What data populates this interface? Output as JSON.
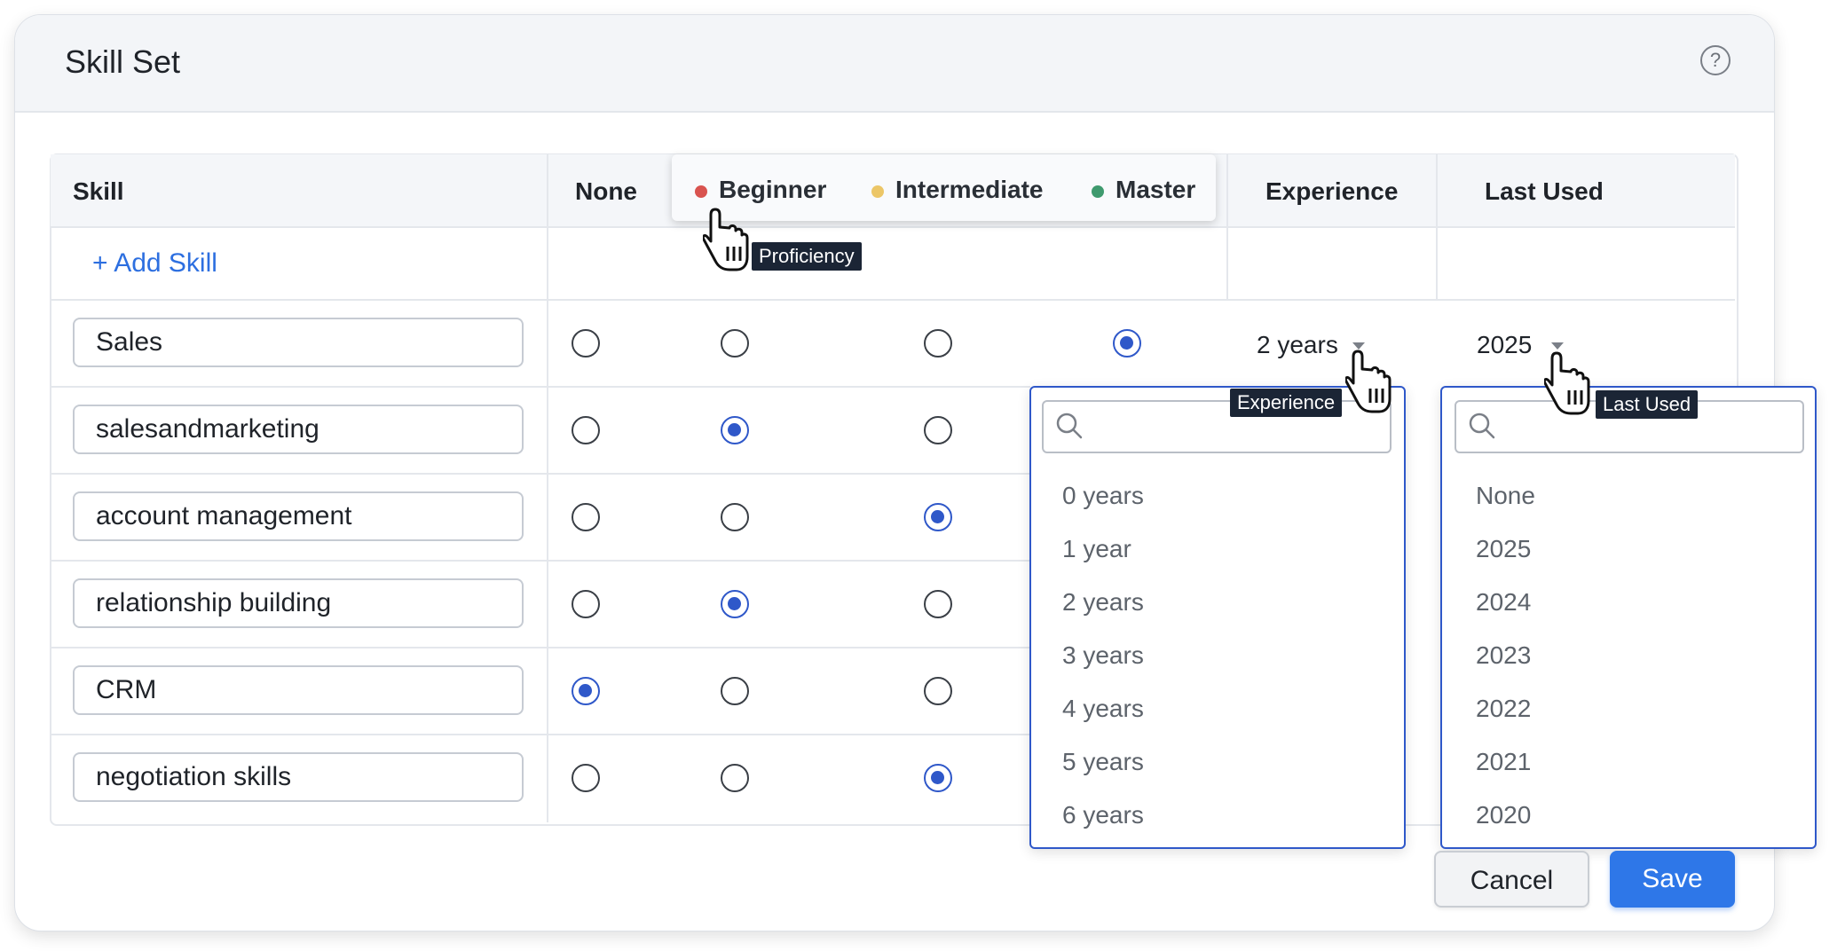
{
  "panel": {
    "title": "Skill Set"
  },
  "columns": {
    "skill": "Skill",
    "none": "None",
    "beginner": "Beginner",
    "intermediate": "Intermediate",
    "master": "Master",
    "experience": "Experience",
    "last_used": "Last Used"
  },
  "legend_colors": {
    "beginner": "#d9534f",
    "intermediate": "#ecc667",
    "master": "#3f9a6e"
  },
  "add_skill": "+ Add Skill",
  "skills": [
    {
      "name": "Sales",
      "proficiency": "master",
      "experience": "2 years",
      "last_used": "2025"
    },
    {
      "name": "salesandmarketing",
      "proficiency": "beginner"
    },
    {
      "name": "account management",
      "proficiency": "intermediate"
    },
    {
      "name": "relationship building",
      "proficiency": "beginner"
    },
    {
      "name": "CRM",
      "proficiency": "none"
    },
    {
      "name": "negotiation skills",
      "proficiency": "intermediate"
    }
  ],
  "tooltips": {
    "proficiency": "Proficiency",
    "experience": "Experience",
    "last_used": "Last Used"
  },
  "experience_dropdown": {
    "search_value": "",
    "options": [
      "0 years",
      "1 year",
      "2 years",
      "3 years",
      "4 years",
      "5 years",
      "6 years"
    ]
  },
  "last_used_dropdown": {
    "search_value": "",
    "options": [
      "None",
      "2025",
      "2024",
      "2023",
      "2022",
      "2021",
      "2020"
    ]
  },
  "buttons": {
    "cancel": "Cancel",
    "save": "Save"
  },
  "icons": {
    "help": "help-circle-icon",
    "search": "search-icon",
    "caret": "caret-down-icon",
    "cursor": "hand-pointer-icon"
  },
  "accent_color": "#2f58c9"
}
